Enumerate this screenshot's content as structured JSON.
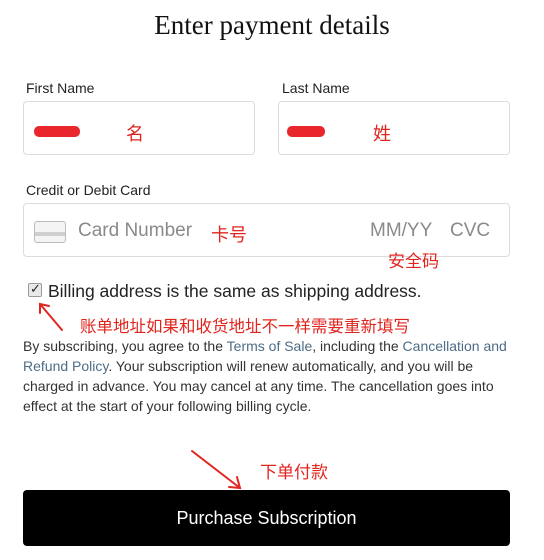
{
  "page": {
    "title": "Enter payment details"
  },
  "first_name": {
    "label": "First Name",
    "annotation": "名"
  },
  "last_name": {
    "label": "Last Name",
    "annotation": "姓"
  },
  "card": {
    "label": "Credit or Debit Card",
    "number_placeholder": "Card Number",
    "number_annotation": "卡号",
    "expiry_placeholder": "MM/YY",
    "cvc_placeholder": "CVC",
    "cvc_annotation": "安全码"
  },
  "billing": {
    "checked": true,
    "label": "Billing address is the same as shipping address.",
    "annotation": "账单地址如果和收货地址不一样需要重新填写"
  },
  "legal": {
    "part1": "By subscribing, you agree to the ",
    "terms_link": "Terms of Sale",
    "part2": ", including the ",
    "policy_link": "Cancellation and Refund Policy",
    "part3": ". Your subscription will renew automatically, and you will be charged in advance. You may cancel at any time. The cancellation goes into effect at the start of your following billing cycle."
  },
  "purchase": {
    "annotation": "下单付款",
    "button_label": "Purchase Subscription"
  },
  "colors": {
    "annotation": "#e0251f",
    "link": "#4e6c86",
    "button": "#000000"
  }
}
